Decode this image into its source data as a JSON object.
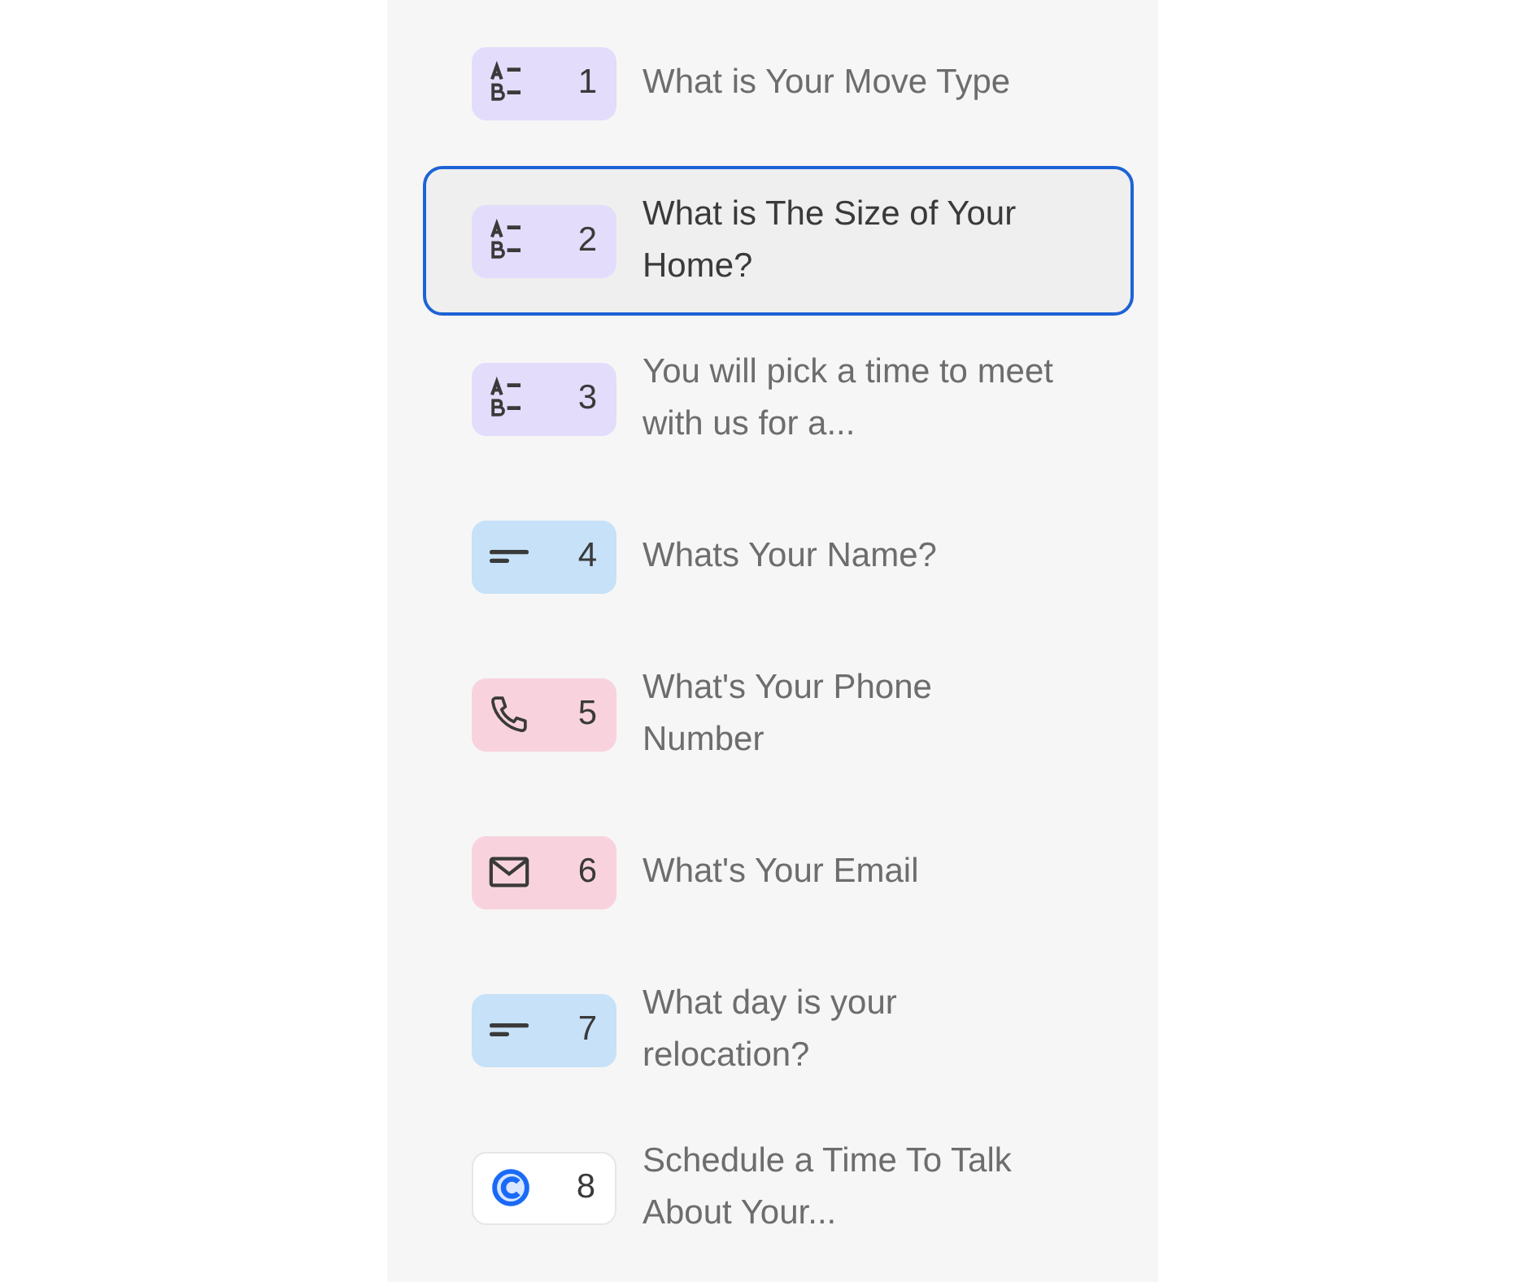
{
  "questions": [
    {
      "kind": "choice",
      "number": "1",
      "title": "What is Your Move Type",
      "selected": false
    },
    {
      "kind": "choice",
      "number": "2",
      "title": "What is The Size of Your Home?",
      "selected": true
    },
    {
      "kind": "choice",
      "number": "3",
      "title": "You will pick a time to meet with us for a...",
      "selected": false
    },
    {
      "kind": "text",
      "number": "4",
      "title": "Whats Your Name?",
      "selected": false
    },
    {
      "kind": "phone",
      "number": "5",
      "title": "What's Your Phone Number",
      "selected": false
    },
    {
      "kind": "email",
      "number": "6",
      "title": "What's Your Email",
      "selected": false
    },
    {
      "kind": "text",
      "number": "7",
      "title": "What day is your relocation?",
      "selected": false
    },
    {
      "kind": "scheduler",
      "number": "8",
      "title": "Schedule a Time To Talk About Your...",
      "selected": false
    }
  ]
}
